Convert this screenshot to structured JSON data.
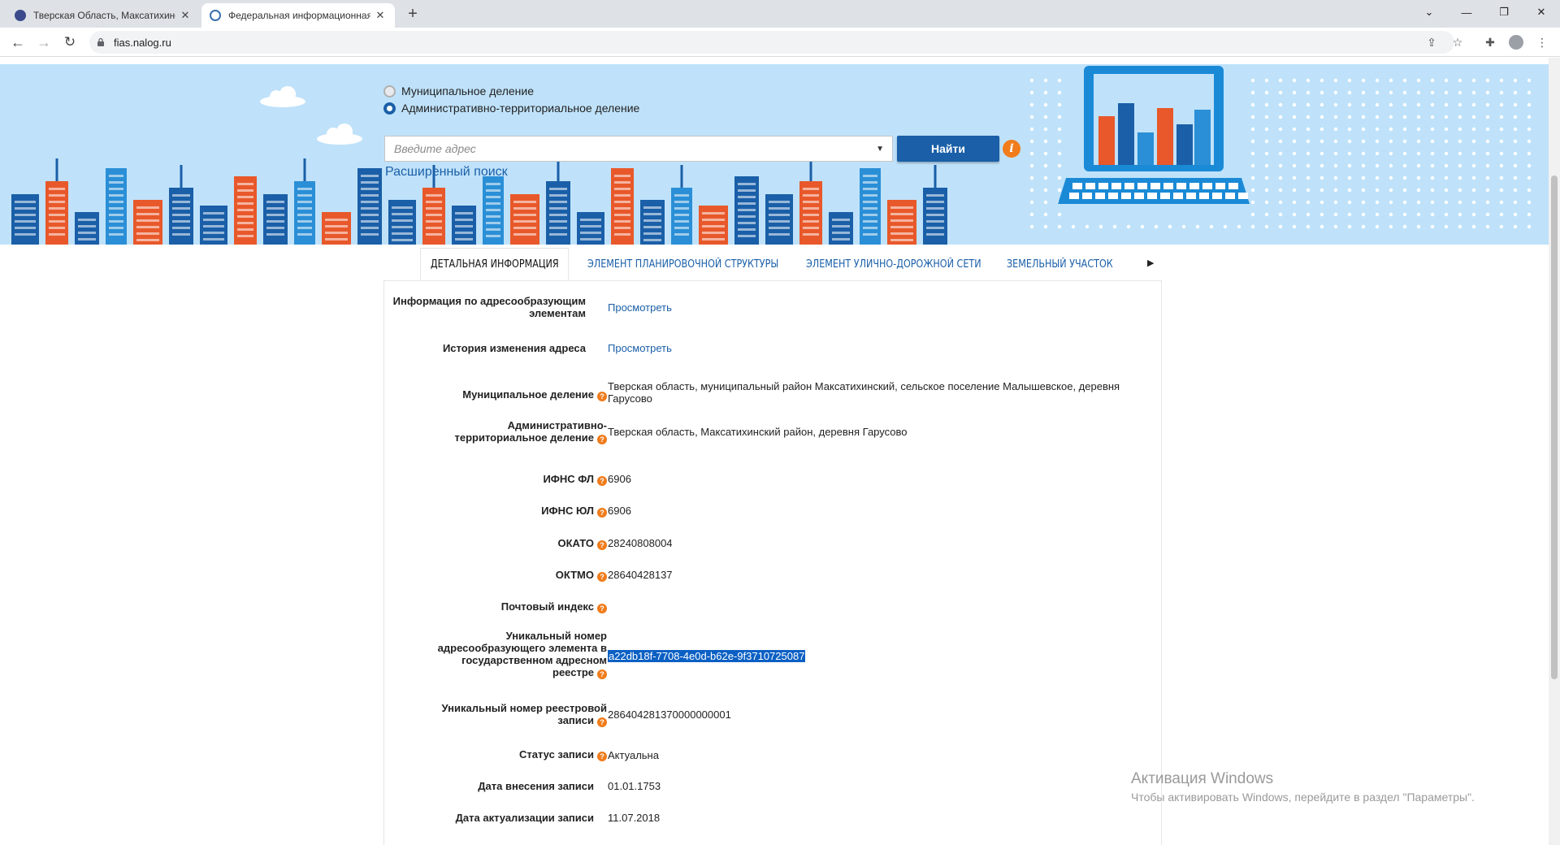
{
  "browser": {
    "tabs": [
      {
        "title": "Тверская Область, Максатихинский",
        "active": false
      },
      {
        "title": "Федеральная информационная адресная система",
        "active": true
      }
    ],
    "url": "fias.nalog.ru",
    "window_controls": {
      "minimize": "—",
      "restore": "❐",
      "close": "✕"
    }
  },
  "search": {
    "radio_municipal": "Муниципальное деление",
    "radio_admin": "Административно-территориальное деление",
    "selected_option": "admin",
    "placeholder": "Введите адрес",
    "find_button": "Найти",
    "advanced_search": "Расширенный поиск"
  },
  "tabs": [
    {
      "label": "ДЕТАЛЬНАЯ ИНФОРМАЦИЯ",
      "active": true
    },
    {
      "label": "ЭЛЕМЕНТ ПЛАНИРОВОЧНОЙ СТРУКТУРЫ",
      "active": false
    },
    {
      "label": "ЭЛЕМЕНТ УЛИЧНО-ДОРОЖНОЙ СЕТИ",
      "active": false
    },
    {
      "label": "ЗЕМЕЛЬНЫЙ УЧАСТОК",
      "active": false
    }
  ],
  "details": [
    {
      "label": "Информация по адресообразующим элементам",
      "value": "Просмотреть",
      "link": true,
      "help": false
    },
    {
      "label": "История изменения адреса",
      "value": "Просмотреть",
      "link": true,
      "help": false
    },
    {
      "label": "Муниципальное деление",
      "value": "Тверская область, муниципальный район Максатихинский, сельское поселение Малышевское, деревня Гарусово",
      "link": false,
      "help": true
    },
    {
      "label": "Административно-территориальное деление",
      "value": "Тверская область, Максатихинский район, деревня Гарусово",
      "link": false,
      "help": true
    },
    {
      "label": "ИФНС ФЛ",
      "value": "6906",
      "link": false,
      "help": true
    },
    {
      "label": "ИФНС ЮЛ",
      "value": "6906",
      "link": false,
      "help": true
    },
    {
      "label": "ОКАТО",
      "value": "28240808004",
      "link": false,
      "help": true
    },
    {
      "label": "ОКТМО",
      "value": "28640428137",
      "link": false,
      "help": true
    },
    {
      "label": "Почтовый индекс",
      "value": "",
      "link": false,
      "help": true
    },
    {
      "label": "Уникальный номер адресообразующего элемента в государственном адресном реестре",
      "value": "a22db18f-7708-4e0d-b62e-9f3710725087",
      "link": false,
      "help": true,
      "selected": true
    },
    {
      "label": "Уникальный номер реестровой записи",
      "value": "286404281370000000001",
      "link": false,
      "help": true
    },
    {
      "label": "Статус записи",
      "value": "Актуальна",
      "link": false,
      "help": true
    },
    {
      "label": "Дата внесения записи",
      "value": "01.01.1753",
      "link": false,
      "help": false
    },
    {
      "label": "Дата актуализации записи",
      "value": "11.07.2018",
      "link": false,
      "help": false
    }
  ],
  "watermark": {
    "title": "Активация Windows",
    "subtitle": "Чтобы активировать Windows, перейдите в раздел \"Параметры\"."
  },
  "colors": {
    "accent": "#1a5fa8",
    "help": "#f07c1b",
    "banner": "#bfe2fa"
  }
}
